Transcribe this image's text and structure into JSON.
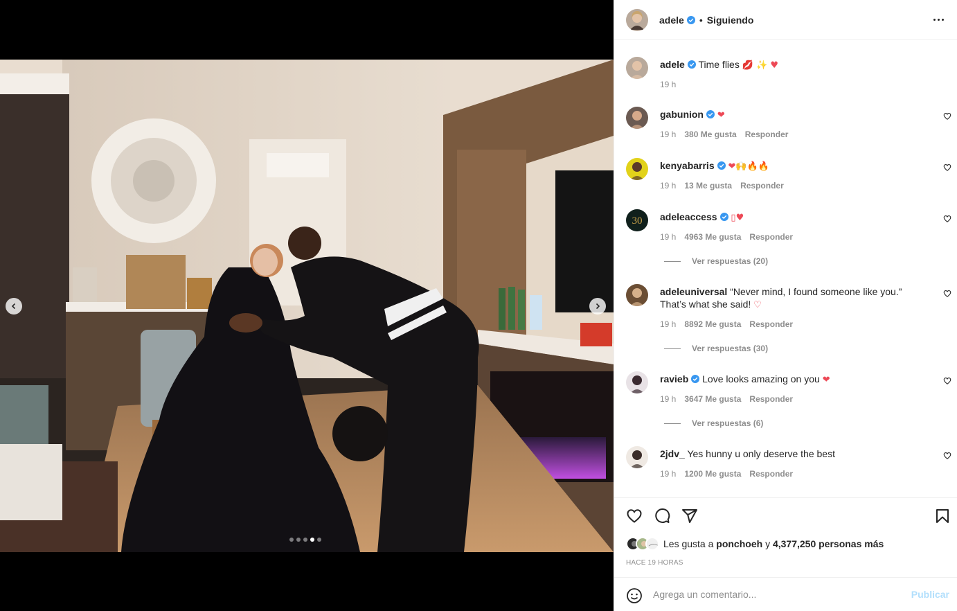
{
  "post": {
    "username": "adele",
    "separator": "•",
    "follow_status": "Siguiendo"
  },
  "media": {
    "slide_count": 5,
    "active_slide": 4
  },
  "comments": [
    {
      "user": "adele",
      "verified": true,
      "text": "Time flies",
      "emoji": "💋 ✨ ♥",
      "time": "19 h",
      "likes": "",
      "reply": "",
      "view_replies": ""
    },
    {
      "user": "gabunion",
      "verified": true,
      "text": "",
      "emoji": "❤",
      "time": "19 h",
      "likes": "380 Me gusta",
      "reply": "Responder",
      "view_replies": ""
    },
    {
      "user": "kenyabarris",
      "verified": true,
      "text": "",
      "emoji": "❤🙌🔥🔥",
      "time": "19 h",
      "likes": "13 Me gusta",
      "reply": "Responder",
      "view_replies": ""
    },
    {
      "user": "adeleaccess",
      "verified": true,
      "text": "",
      "emoji": "▯♥",
      "time": "19 h",
      "likes": "4963 Me gusta",
      "reply": "Responder",
      "view_replies": "Ver respuestas (20)"
    },
    {
      "user": "adeleuniversal",
      "verified": false,
      "text": "“Never mind, I found someone like you.” That’s what she said!",
      "emoji": "♡",
      "time": "19 h",
      "likes": "8892 Me gusta",
      "reply": "Responder",
      "view_replies": "Ver respuestas (30)"
    },
    {
      "user": "ravieb",
      "verified": true,
      "text": "Love looks amazing on you",
      "emoji": "❤",
      "time": "19 h",
      "likes": "3647 Me gusta",
      "reply": "Responder",
      "view_replies": "Ver respuestas (6)"
    },
    {
      "user": "2jdv_",
      "verified": false,
      "text": "Yes hunny u only deserve the best",
      "emoji": "",
      "time": "19 h",
      "likes": "1200 Me gusta",
      "reply": "Responder",
      "view_replies": ""
    }
  ],
  "likes": {
    "prefix": "Les gusta a",
    "user": "ponchoeh",
    "connector": "y",
    "others": "4,377,250 personas más"
  },
  "time_ago": "HACE 19 HORAS",
  "add_comment": {
    "placeholder": "Agrega un comentario...",
    "publish_label": "Publicar"
  },
  "icons": {
    "like": "heart-icon",
    "comment": "comment-icon",
    "share": "share-icon",
    "save": "bookmark-icon",
    "emoji": "emoji-icon"
  },
  "colors": {
    "verified": "#3897f0",
    "text": "#262626",
    "muted": "#8e8e8e",
    "publish_disabled": "#b2dffc",
    "heart_red": "#ed4956"
  }
}
